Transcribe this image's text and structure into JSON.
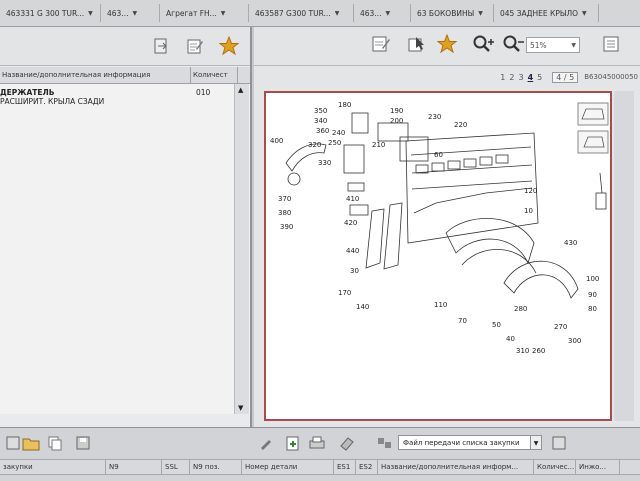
{
  "breadcrumbs": [
    {
      "label": "463331 G 300 TUR...",
      "has_arrow": true
    },
    {
      "label": "463...",
      "has_arrow": true
    },
    {
      "label": "Агрегат FH...",
      "has_arrow": true
    },
    {
      "label": "463587 G300 TUR...",
      "has_arrow": true
    },
    {
      "label": "463...",
      "has_arrow": true
    },
    {
      "label": "63 БОКОВИНЫ",
      "has_arrow": true
    },
    {
      "label": "045 ЗАДНЕЕ КРЫЛО",
      "has_arrow": true
    }
  ],
  "left_table": {
    "headers": [
      "Название/дополнительная информация",
      "Количест"
    ],
    "rows": [
      {
        "name": "ДЕРЖАТЕЛЬ",
        "info": "РАСШИРИТ. КРЫЛА СЗАДИ",
        "qty": "010"
      }
    ]
  },
  "right_toolbar": {
    "zoom": "51%"
  },
  "pager": {
    "pages": [
      "1",
      "2",
      "3",
      "4",
      "5"
    ],
    "current": "4",
    "position": "4 / 5",
    "ref": "B63045000050"
  },
  "diagram_labels": [
    "350",
    "340",
    "360",
    "320",
    "330",
    "180",
    "190",
    "200",
    "230",
    "220",
    "240",
    "250",
    "210",
    "60",
    "400",
    "370",
    "380",
    "390",
    "410",
    "420",
    "440",
    "30",
    "170",
    "140",
    "110",
    "70",
    "50",
    "280",
    "100",
    "90",
    "80",
    "270",
    "300",
    "40",
    "310",
    "260",
    "430",
    "120",
    "10"
  ],
  "bottom_bar": {
    "transfer_file_label": "Файл передачи списка закупки",
    "left_label": "закупки",
    "headers": [
      "N9",
      "SSL",
      "N9 поз.",
      "Номер детали",
      "ES1",
      "ES2",
      "Название/дополнительная информ...",
      "Количес...",
      "Инжо..."
    ]
  },
  "colors": {
    "accent": "#a94b4b",
    "star": "#e0a020"
  }
}
